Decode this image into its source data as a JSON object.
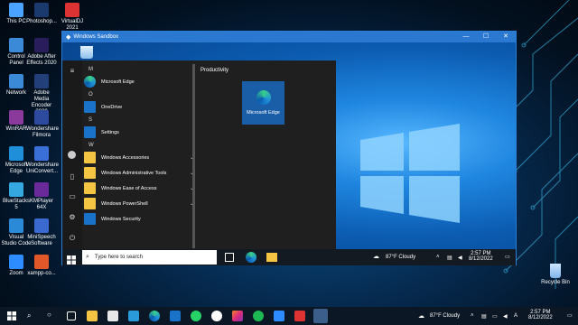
{
  "desktop_icons": [
    {
      "label": "This PC",
      "color": "#4aa3ff"
    },
    {
      "label": "Photoshop...",
      "color": "#1a3a6e"
    },
    {
      "label": "VirtualDJ 2021",
      "color": "#d33"
    },
    {
      "label": "Control Panel",
      "color": "#3a8ad8"
    },
    {
      "label": "Adobe After Effects 2020",
      "color": "#2a1d5c"
    },
    {
      "label": "Network",
      "color": "#3a8ad8"
    },
    {
      "label": "Adobe Media Encoder 2020",
      "color": "#233f7a"
    },
    {
      "label": "WinRAR",
      "color": "#8a3a9a"
    },
    {
      "label": "Wondershare Filmora",
      "color": "#2d4a9e"
    },
    {
      "label": "Microsoft Edge",
      "color": "#1e8fd8"
    },
    {
      "label": "Wondershare UniConvert...",
      "color": "#3a6fd8"
    },
    {
      "label": "BlueStacks 5",
      "color": "#35a8e0"
    },
    {
      "label": "KMPlayer 64X",
      "color": "#6a2a9a"
    },
    {
      "label": "Visual Studio Code",
      "color": "#2a8ad8"
    },
    {
      "label": "MiniSpeech Software",
      "color": "#3a6ad0"
    },
    {
      "label": "Zoom",
      "color": "#2d8cff"
    },
    {
      "label": "xampp-co...",
      "color": "#e0582a"
    }
  ],
  "recycle_bin": {
    "label": "Recycle Bin"
  },
  "sandbox_window": {
    "title": "Windows Sandbox",
    "minimize": "—",
    "maximize": "☐",
    "close": "✕",
    "recycle_label": ""
  },
  "start_menu": {
    "groups": [
      {
        "header": "M",
        "items": [
          {
            "label": "Microsoft Edge",
            "icon": "edge-icon",
            "color": "#1e8fd8"
          }
        ]
      },
      {
        "header": "O",
        "items": [
          {
            "label": "OneDrive",
            "icon": "onedrive-icon",
            "color": "#1a73c8"
          }
        ]
      },
      {
        "header": "S",
        "items": [
          {
            "label": "Settings",
            "icon": "gear-icon",
            "color": "#1a73c8"
          }
        ]
      },
      {
        "header": "W",
        "items": [
          {
            "label": "Windows Accessories",
            "icon": "folder-icon",
            "color": "#f4c542",
            "chevron": "⌄"
          },
          {
            "label": "Windows Administrative Tools",
            "icon": "folder-icon",
            "color": "#f4c542",
            "chevron": "⌄"
          },
          {
            "label": "Windows Ease of Access",
            "icon": "folder-icon",
            "color": "#f4c542",
            "chevron": "⌄"
          },
          {
            "label": "Windows PowerShell",
            "icon": "folder-icon",
            "color": "#f4c542",
            "chevron": "⌄"
          },
          {
            "label": "Windows Security",
            "icon": "shield-icon",
            "color": "#1a73c8"
          }
        ]
      }
    ],
    "tiles_header": "Productivity",
    "tile": {
      "label": "Microsoft Edge"
    }
  },
  "sandbox_taskbar": {
    "search_placeholder": "Type here to search",
    "weather": "87°F  Cloudy",
    "time": "2:57 PM",
    "date": "8/12/2022"
  },
  "taskbar": {
    "weather": "87°F  Cloudy",
    "time": "2:57 PM",
    "date": "8/12/2022"
  }
}
